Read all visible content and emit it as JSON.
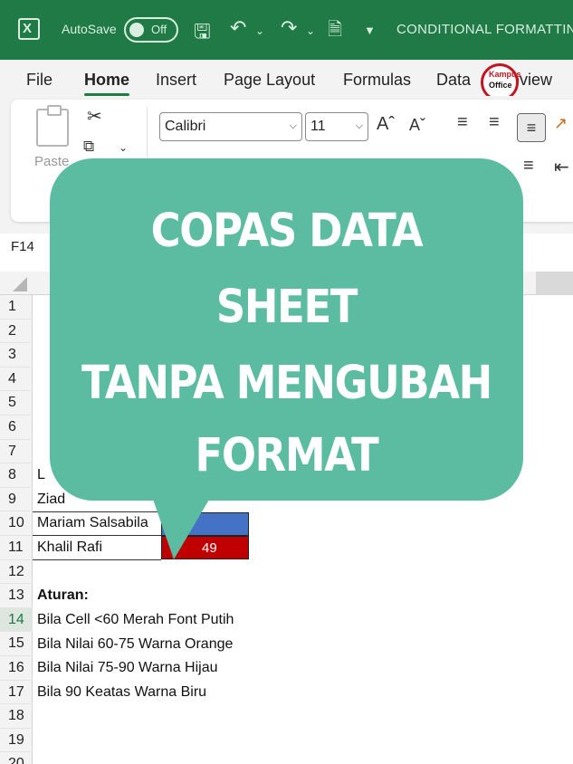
{
  "titlebar": {
    "autosave_label": "AutoSave",
    "autosave_state": "Off",
    "doc_title": "CONDITIONAL FORMATTING"
  },
  "menu": {
    "tabs": [
      "File",
      "Home",
      "Insert",
      "Page Layout",
      "Formulas",
      "Data",
      "Review"
    ],
    "active_tab": "Home",
    "logo_line1": "Kampus",
    "logo_line2": "Office"
  },
  "ribbon": {
    "paste_label": "Paste",
    "font_name": "Calibri",
    "font_size": "11"
  },
  "formula_bar": {
    "name_box": "F14"
  },
  "sheet": {
    "row_numbers": [
      "1",
      "2",
      "3",
      "4",
      "5",
      "6",
      "7",
      "8",
      "9",
      "10",
      "11",
      "12",
      "13",
      "14",
      "15",
      "16",
      "17",
      "18",
      "19",
      "20"
    ],
    "selected_row": "14",
    "row8": "L",
    "row9": "Ziad",
    "row10": "Mariam Salsabila",
    "row11": "Khalil Rafi",
    "row11_value": "49",
    "row10_color": "#4472c4",
    "row11_color": "#c00000",
    "row13": "Aturan:",
    "row14": "Bila Cell <60 Merah Font Putih",
    "row15": "Bila Nilai 60-75 Warna Orange",
    "row16": "Bila Nilai 75-90 Warna Hijau",
    "row17": "Bila 90 Keatas Warna Biru"
  },
  "overlay": {
    "line1": "COPAS DATA",
    "line2": "SHEET",
    "line3": "TANPA MENGUBAH",
    "line4": "FORMAT",
    "bubble_color": "#5bbca2"
  }
}
